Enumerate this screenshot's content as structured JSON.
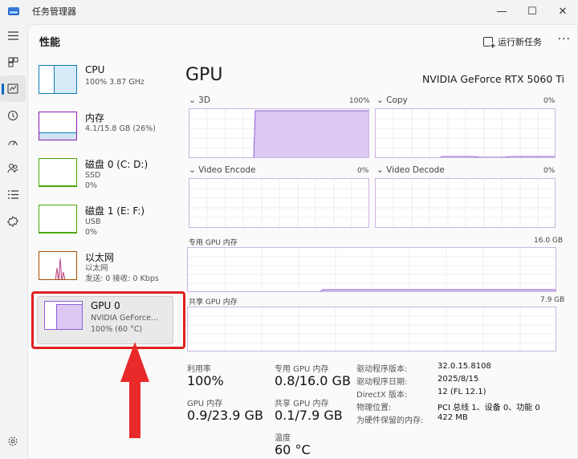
{
  "window": {
    "title": "任务管理器",
    "controls": [
      "—",
      "☐",
      "✕"
    ]
  },
  "header": {
    "title": "性能",
    "run_task_label": "运行新任务",
    "more_label": "···"
  },
  "rail": {
    "icons": [
      "menu-icon",
      "processes-icon",
      "performance-icon",
      "history-icon",
      "startup-icon",
      "users-icon",
      "details-icon",
      "services-icon"
    ],
    "settings_icon": "gear-icon"
  },
  "devices": [
    {
      "name": "CPU",
      "sub1": "100%  3.87 GHz",
      "sub2": ""
    },
    {
      "name": "内存",
      "sub1": "4.1/15.8 GB (26%)",
      "sub2": ""
    },
    {
      "name": "磁盘 0 (C: D:)",
      "sub1": "SSD",
      "sub2": "0%"
    },
    {
      "name": "磁盘 1 (E: F:)",
      "sub1": "USB",
      "sub2": "0%"
    },
    {
      "name": "以太网",
      "sub1": "以太网",
      "sub2": "发送: 0 接收: 0 Kbps"
    },
    {
      "name": "GPU 0",
      "sub1": "NVIDIA GeForce...",
      "sub2": "100% (60 °C)"
    }
  ],
  "gpu": {
    "title": "GPU",
    "model": "NVIDIA GeForce RTX 5060 Ti",
    "engines": [
      {
        "label": "3D",
        "max": "100%",
        "utilization": 1.0
      },
      {
        "label": "Copy",
        "max": "0%",
        "utilization": 0.02
      },
      {
        "label": "Video Encode",
        "max": "0%",
        "utilization": 0
      },
      {
        "label": "Video Decode",
        "max": "0%",
        "utilization": 0
      }
    ],
    "dedicated_mem": {
      "label": "专用 GPU 内存",
      "max": "16.0 GB",
      "level": 0.05
    },
    "shared_mem": {
      "label": "共享 GPU 内存",
      "max": "7.9 GB",
      "level": 0.013
    }
  },
  "stats": {
    "utilization_label": "利用率",
    "utilization_value": "100%",
    "dedicated_label": "专用 GPU 内存",
    "dedicated_value": "0.8/16.0 GB",
    "gpu_mem_label": "GPU 内存",
    "gpu_mem_value": "0.9/23.9 GB",
    "shared_label": "共享 GPU 内存",
    "shared_value": "0.1/7.9 GB",
    "temp_label": "温度",
    "temp_value": "60 °C"
  },
  "info": [
    {
      "key": "驱动程序版本:",
      "value": "32.0.15.8108"
    },
    {
      "key": "驱动程序日期:",
      "value": "2025/8/15"
    },
    {
      "key": "DirectX 版本:",
      "value": "12 (FL 12.1)"
    },
    {
      "key": "物理位置:",
      "value": "PCI 总线 1、设备 0、功能 0"
    },
    {
      "key": "为硬件保留的内存:",
      "value": "422 MB"
    }
  ],
  "colors": {
    "highlight_red": "#e02020",
    "cpu_blue": "#117dbb",
    "gpu_purple": "#8e5bd6"
  }
}
